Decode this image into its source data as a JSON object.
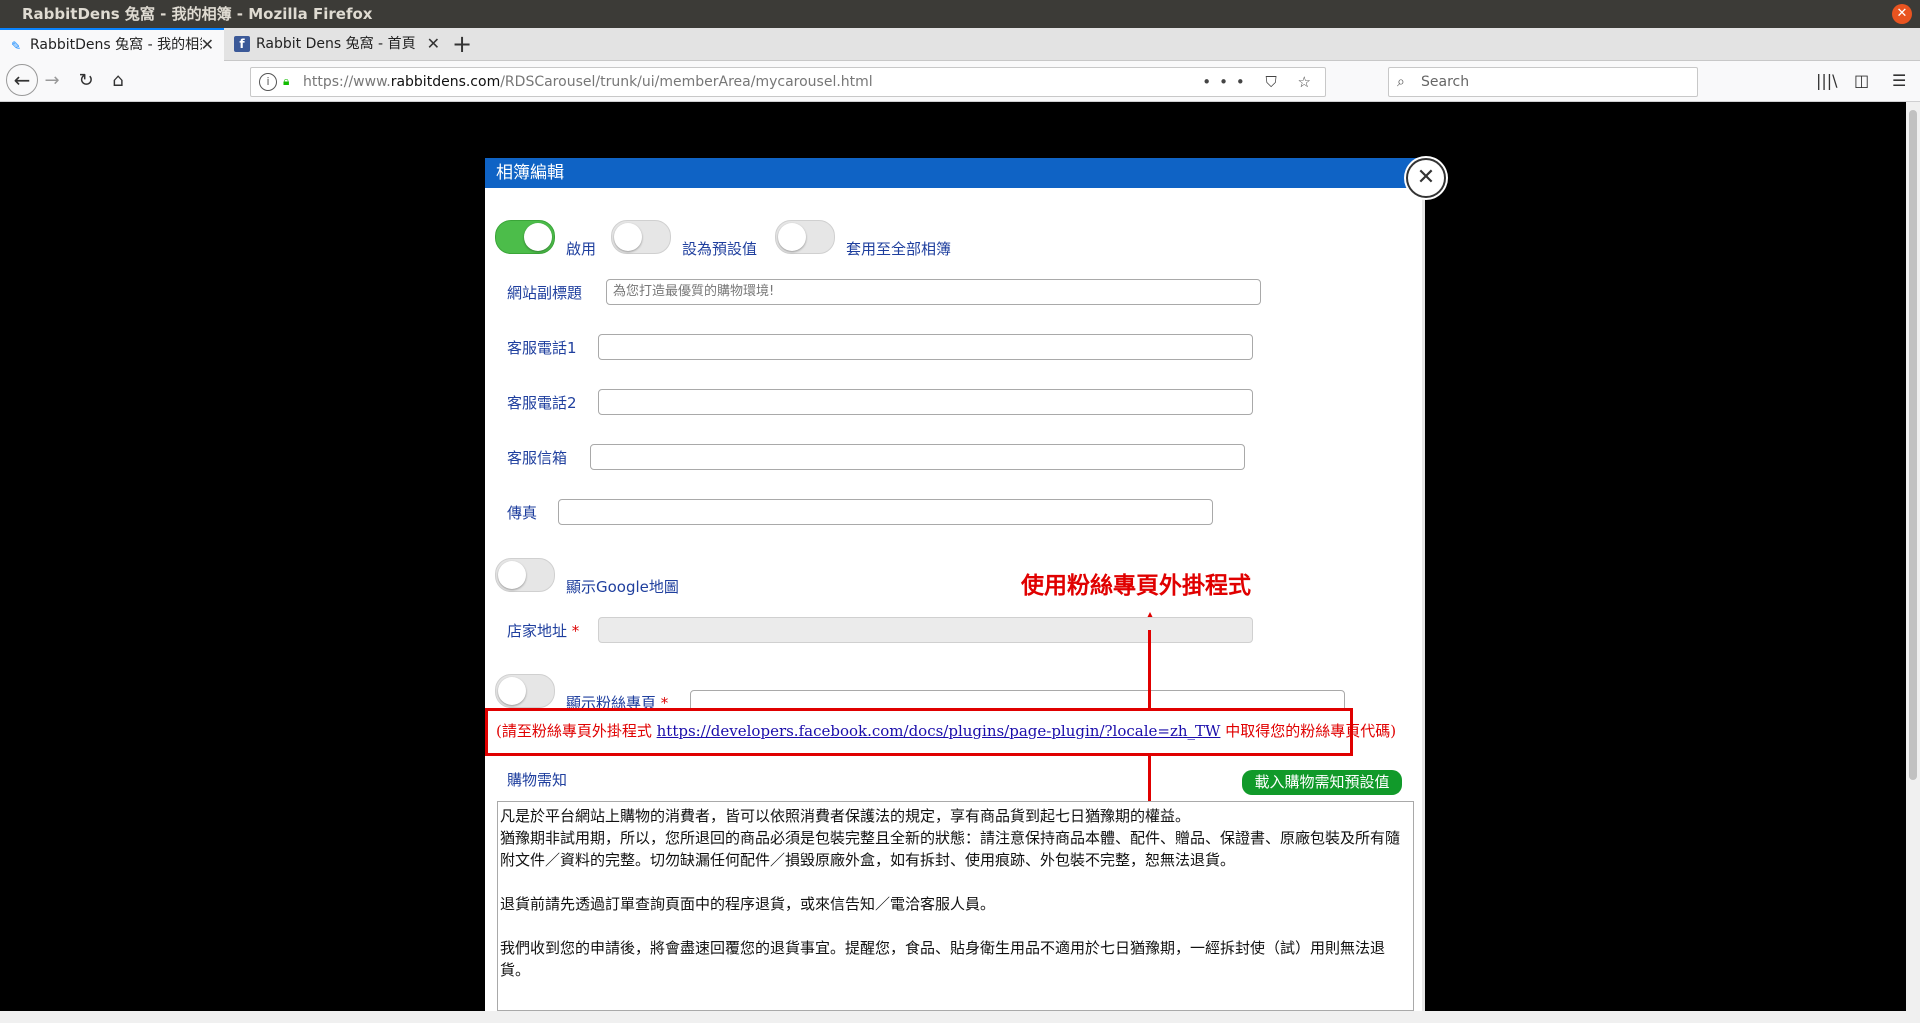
{
  "window": {
    "title": "RabbitDens 兔窩 - 我的相簿 - Mozilla Firefox",
    "close_glyph": "✕"
  },
  "tabs": [
    {
      "label": "RabbitDens 兔窩 - 我的相簿",
      "icon": "rabbit-favicon",
      "close": "✕"
    },
    {
      "label": "Rabbit Dens 兔窩 - 首頁",
      "icon": "facebook-favicon",
      "close": "✕"
    }
  ],
  "new_tab": "+",
  "nav": {
    "back": "←",
    "forward": "→",
    "reload": "↻",
    "home": "⌂",
    "url_prefix": "https://www.",
    "url_domain": "rabbitdens.com",
    "url_path": "/RDSCarousel/trunk/ui/memberArea/mycarousel.html",
    "url_icons": "••• ⛉ ☆",
    "search_placeholder": "Search",
    "search_glyph": "⌕",
    "library_glyph": "|||\\",
    "sidebar_glyph": "◫",
    "menu_glyph": "☰"
  },
  "modal": {
    "title": "相簿編輯",
    "close_glyph": "✕",
    "toggles": [
      {
        "label": "啟用",
        "on": true
      },
      {
        "label": "設為預設值",
        "on": false
      },
      {
        "label": "套用至全部相簿",
        "on": false
      }
    ],
    "fields": {
      "subtitle_label": "網站副標題",
      "subtitle_placeholder": "為您打造最優質的購物環境!",
      "phone1_label": "客服電話1",
      "phone2_label": "客服電話2",
      "email_label": "客服信箱",
      "fax_label": "傳真"
    },
    "google_map": {
      "label": "顯示Google地圖",
      "on": false
    },
    "address_label": "店家地址",
    "required_mark": "*",
    "fanpage": {
      "label": "顯示粉絲專頁",
      "on": false
    },
    "annotation_title": "使用粉絲專頁外掛程式",
    "notice": {
      "prefix": "(請至粉絲專頁外掛程式 ",
      "link": "https://developers.facebook.com/docs/plugins/page-plugin/?locale=zh_TW",
      "suffix": " 中取得您的粉絲專頁代碼)"
    },
    "shopping": {
      "label": "購物需知",
      "load_button": "載入購物需知預設值",
      "text": [
        "凡是於平台網站上購物的消費者，皆可以依照消費者保護法的規定，享有商品貨到起七日猶豫期的權益。",
        "猶豫期非試用期，所以，您所退回的商品必須是包裝完整且全新的狀態：請注意保持商品本體、配件、贈品、保證書、原廠包裝及所有隨附文件／資料的完整。切勿缺漏任何配件／損毀原廠外盒，如有拆封、使用痕跡、外包裝不完整，恕無法退貨。",
        "",
        "退貨前請先透過訂單查詢頁面中的程序退貨，或來信告知／電洽客服人員。",
        "",
        "我們收到您的申請後，將會盡速回覆您的退貨事宜。提醒您，食品、貼身衛生用品不適用於七日猶豫期，一經拆封使（試）用則無法退貨。"
      ]
    }
  }
}
